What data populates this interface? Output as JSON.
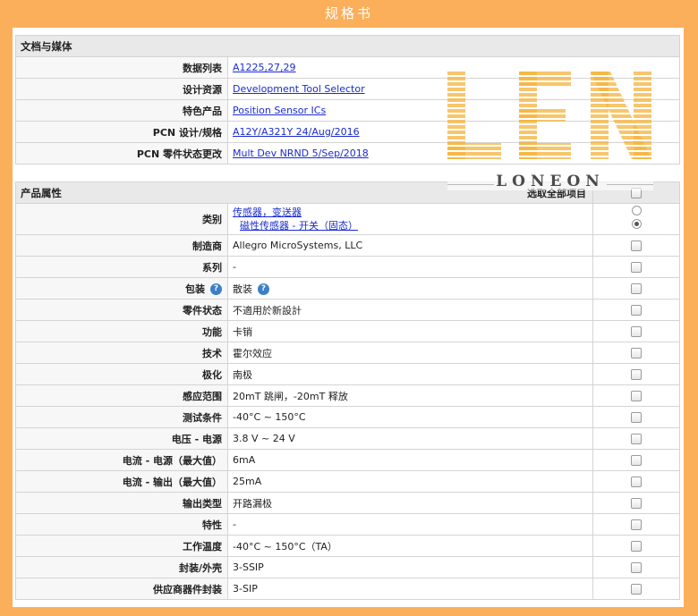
{
  "header": {
    "title": "规格书"
  },
  "docs": {
    "heading": "文档与媒体",
    "rows": [
      {
        "label": "数据列表",
        "value": "A1225,27,29"
      },
      {
        "label": "设计资源",
        "value": "Development Tool Selector"
      },
      {
        "label": "特色产品",
        "value": "Position Sensor ICs"
      },
      {
        "label": "PCN 设计/规格",
        "value": "A12Y/A321Y 24/Aug/2016"
      },
      {
        "label": "PCN 零件状态更改",
        "value": "Mult Dev NRND 5/Sep/2018"
      }
    ]
  },
  "attrs": {
    "heading": "产品属性",
    "select_all": "选取全部项目",
    "category": {
      "label": "类别",
      "line1": "传感器，变送器",
      "line2": "磁性传感器 - 开关（固态）"
    },
    "rows": [
      {
        "label": "制造商",
        "value": "Allegro MicroSystems, LLC"
      },
      {
        "label": "系列",
        "value": "-"
      },
      {
        "label": "包装",
        "value": "散装"
      },
      {
        "label": "零件状态",
        "value": "不適用於新設計"
      },
      {
        "label": "功能",
        "value": "卡销"
      },
      {
        "label": "技术",
        "value": "霍尔效应"
      },
      {
        "label": "极化",
        "value": "南极"
      },
      {
        "label": "感应范围",
        "value": "20mT 跳闸，-20mT 释放"
      },
      {
        "label": "测试条件",
        "value": "-40°C ~ 150°C"
      },
      {
        "label": "电压 - 电源",
        "value": "3.8 V ~ 24 V"
      },
      {
        "label": "电流 - 电源（最大值）",
        "value": "6mA"
      },
      {
        "label": "电流 - 输出（最大值）",
        "value": "25mA"
      },
      {
        "label": "输出类型",
        "value": "开路漏极"
      },
      {
        "label": "特性",
        "value": "-"
      },
      {
        "label": "工作温度",
        "value": "-40°C ~ 150°C（TA）"
      },
      {
        "label": "封装/外壳",
        "value": "3-SSIP"
      },
      {
        "label": "供应商器件封装",
        "value": "3-SIP"
      }
    ]
  },
  "watermark": {
    "logo": "LEN",
    "brand": "LONEON"
  },
  "colors": {
    "frame": "#fbaf5b",
    "link": "#1a2bd0",
    "help": "#3d7fc8"
  }
}
